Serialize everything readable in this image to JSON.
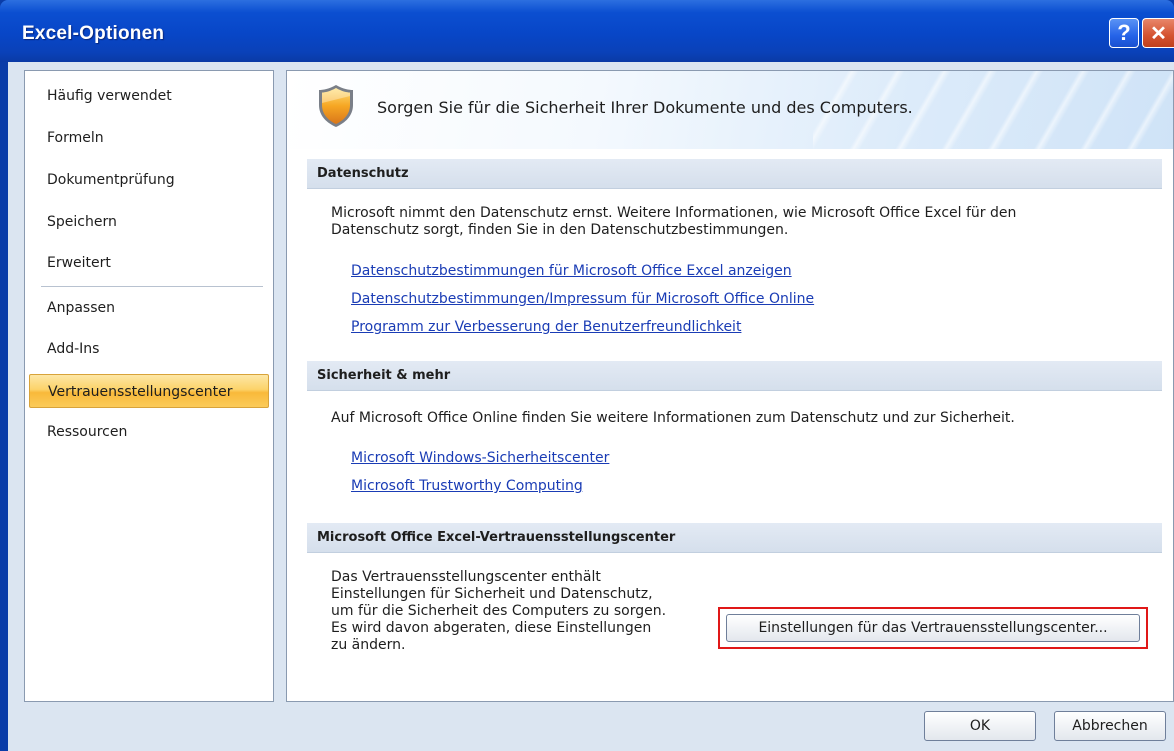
{
  "window": {
    "title": "Excel-Optionen",
    "help_label": "?",
    "close_label": "✕"
  },
  "nav": {
    "items": [
      {
        "label": "Häufig verwendet"
      },
      {
        "label": "Formeln"
      },
      {
        "label": "Dokumentprüfung"
      },
      {
        "label": "Speichern"
      },
      {
        "label": "Erweitert"
      },
      {
        "label": "Anpassen"
      },
      {
        "label": "Add-Ins"
      },
      {
        "label": "Vertrauensstellungscenter",
        "selected": true
      },
      {
        "label": "Ressourcen"
      }
    ]
  },
  "banner": {
    "text": "Sorgen Sie für die Sicherheit Ihrer Dokumente und des Computers.",
    "icon": "security-shield-icon"
  },
  "privacy": {
    "header": "Datenschutz",
    "text_line1": "Microsoft nimmt den Datenschutz ernst. Weitere Informationen, wie Microsoft Office Excel für den",
    "text_line2": "Datenschutz sorgt, finden Sie in den Datenschutzbestimmungen.",
    "links": [
      "Datenschutzbestimmungen für Microsoft Office Excel anzeigen",
      "Datenschutzbestimmungen/Impressum für Microsoft Office Online",
      "Programm zur Verbesserung der Benutzerfreundlichkeit"
    ]
  },
  "security": {
    "header": "Sicherheit & mehr",
    "text": "Auf Microsoft Office Online finden Sie weitere Informationen zum Datenschutz und zur Sicherheit.",
    "links": [
      "Microsoft Windows-Sicherheitscenter",
      "Microsoft Trustworthy Computing"
    ]
  },
  "trust_center": {
    "header": "Microsoft Office Excel-Vertrauensstellungscenter",
    "lines": [
      "Das Vertrauensstellungscenter enthält",
      "Einstellungen für Sicherheit und Datenschutz,",
      "um für die Sicherheit des Computers zu sorgen.",
      "Es wird davon abgeraten, diese Einstellungen",
      "zu ändern."
    ],
    "button_label": "Einstellungen für das Vertrauensstellungscenter..."
  },
  "footer": {
    "ok_label": "OK",
    "cancel_label": "Abbrechen"
  },
  "colors": {
    "titlebar": "#0846c7",
    "selection": "#f9b93a",
    "link": "#1a3cb5",
    "highlight_frame": "#e01818"
  }
}
